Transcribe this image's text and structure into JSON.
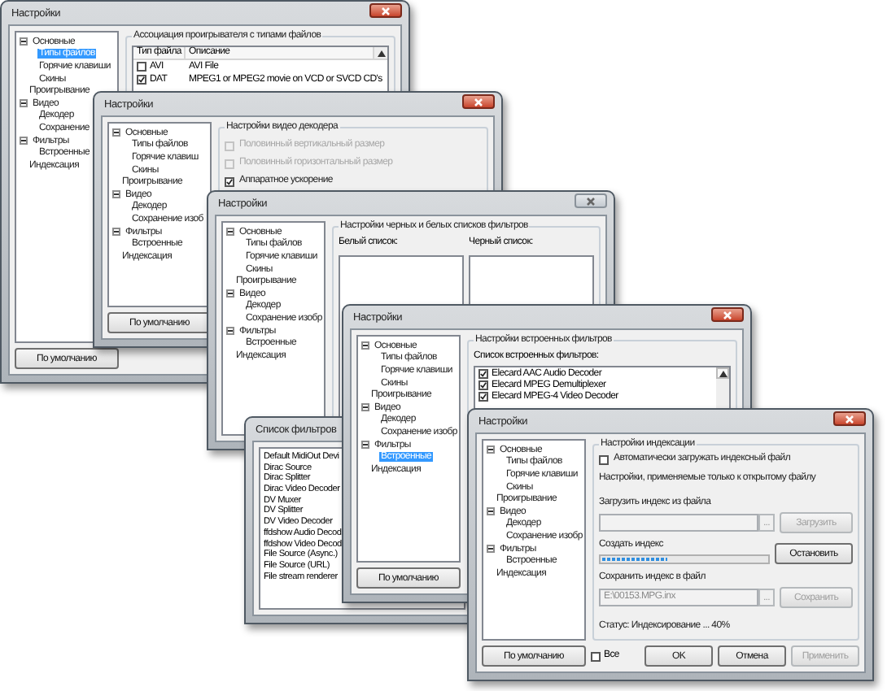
{
  "windows": [
    {
      "kind": "file_types",
      "title": "Настройки",
      "close_button": {
        "active": true
      },
      "default_button": "По умолчанию",
      "tree": [
        {
          "label": "Основные",
          "expanded": true,
          "selected": false,
          "children": [
            {
              "label": "Типы файлов",
              "selected": true
            },
            {
              "label": "Горячие клавиши",
              "selected": false
            },
            {
              "label": "Скины",
              "selected": false
            }
          ]
        },
        {
          "label": "Проигрывание",
          "selected": false
        },
        {
          "label": "Видео",
          "expanded": true,
          "selected": false,
          "children": [
            {
              "label": "Декодер",
              "selected": false
            },
            {
              "label": "Сохранение",
              "selected": false
            }
          ]
        },
        {
          "label": "Фильтры",
          "expanded": true,
          "selected": false,
          "children": [
            {
              "label": "Встроенные",
              "selected": false
            }
          ]
        },
        {
          "label": "Индексация",
          "selected": false
        }
      ],
      "group_title": "Ассоциация проигрывателя с типами файлов",
      "table": {
        "columns": [
          "Тип файла",
          "Описание"
        ],
        "rows": [
          {
            "checked": false,
            "cells": [
              "AVI",
              "AVI File"
            ]
          },
          {
            "checked": true,
            "cells": [
              "DAT",
              "MPEG1 or MPEG2 movie on VCD or SVCD CD's"
            ]
          }
        ]
      }
    },
    {
      "kind": "video_decoder",
      "title": "Настройки",
      "close_button": {
        "active": true
      },
      "default_button": "По умолчанию",
      "tree": [
        {
          "label": "Основные",
          "expanded": true,
          "selected": false,
          "children": [
            {
              "label": "Типы файлов",
              "selected": false
            },
            {
              "label": "Горячие клавиш",
              "selected": false
            },
            {
              "label": "Скины",
              "selected": false
            }
          ]
        },
        {
          "label": "Проигрывание",
          "selected": false
        },
        {
          "label": "Видео",
          "expanded": true,
          "selected": false,
          "children": [
            {
              "label": "Декодер",
              "selected": false
            },
            {
              "label": "Сохранение изоб",
              "selected": false
            }
          ]
        },
        {
          "label": "Фильтры",
          "expanded": true,
          "selected": false,
          "children": [
            {
              "label": "Встроенные",
              "selected": false
            }
          ]
        },
        {
          "label": "Индексация",
          "selected": false
        }
      ],
      "group_title": "Настройки видео декодера",
      "options": [
        {
          "label": "Половинный вертикальный размер",
          "checked": false,
          "disabled": true
        },
        {
          "label": "Половинный горизонтальный размер",
          "checked": false,
          "disabled": true
        },
        {
          "label": "Аппаратное ускорение",
          "checked": true,
          "disabled": false
        }
      ]
    },
    {
      "kind": "filter_lists",
      "title": "Настройки",
      "close_button": {
        "active": false
      },
      "tree": [
        {
          "label": "Основные",
          "expanded": true,
          "selected": false,
          "children": [
            {
              "label": "Типы файлов",
              "selected": false
            },
            {
              "label": "Горячие клавиши",
              "selected": false
            },
            {
              "label": "Скины",
              "selected": false
            }
          ]
        },
        {
          "label": "Проигрывание",
          "selected": false
        },
        {
          "label": "Видео",
          "expanded": true,
          "selected": false,
          "children": [
            {
              "label": "Декодер",
              "selected": false
            },
            {
              "label": "Сохранение изобр",
              "selected": false
            }
          ]
        },
        {
          "label": "Фильтры",
          "expanded": true,
          "selected": false,
          "children": [
            {
              "label": "Встроенные",
              "selected": false
            }
          ]
        },
        {
          "label": "Индексация",
          "selected": false
        }
      ],
      "group_title": "Настройки черных и белых списков фильтров",
      "lists": [
        {
          "label": "Белый список:"
        },
        {
          "label": "Черный список:"
        }
      ]
    },
    {
      "kind": "filter_list",
      "title": "Список фильтров",
      "items": [
        "Default MidiOut Devi",
        "Dirac Source",
        "Dirac Splitter",
        "Dirac Video Decoder",
        "DV Muxer",
        "DV Splitter",
        "DV Video Decoder",
        "ffdshow Audio Decod",
        "ffdshow Video Decod",
        "File Source (Async.)",
        "File Source (URL)",
        "File stream renderer"
      ]
    },
    {
      "kind": "builtin_filters",
      "title": "Настройки",
      "close_button": {
        "active": true
      },
      "default_button": "По умолчанию",
      "tree": [
        {
          "label": "Основные",
          "expanded": true,
          "selected": false,
          "children": [
            {
              "label": "Типы файлов",
              "selected": false
            },
            {
              "label": "Горячие клавиши",
              "selected": false
            },
            {
              "label": "Скины",
              "selected": false
            }
          ]
        },
        {
          "label": "Проигрывание",
          "selected": false
        },
        {
          "label": "Видео",
          "expanded": true,
          "selected": false,
          "children": [
            {
              "label": "Декодер",
              "selected": false
            },
            {
              "label": "Сохранение изобр",
              "selected": false
            }
          ]
        },
        {
          "label": "Фильтры",
          "expanded": true,
          "selected": false,
          "children": [
            {
              "label": "Встроенные",
              "selected": true
            }
          ]
        },
        {
          "label": "Индексация",
          "selected": false
        }
      ],
      "group_title": "Настройки встроенных фильтров",
      "list_label": "Список встроенных фильтров:",
      "filters": [
        {
          "label": "Elecard AAC Audio Decoder",
          "checked": true
        },
        {
          "label": "Elecard MPEG Demultiplexer",
          "checked": true
        },
        {
          "label": "Elecard MPEG-4 Video Decoder",
          "checked": true
        }
      ]
    },
    {
      "kind": "indexing",
      "title": "Настройки",
      "close_button": {
        "active": true
      },
      "default_button": "По умолчанию",
      "tree": [
        {
          "label": "Основные",
          "expanded": true,
          "selected": false,
          "children": [
            {
              "label": "Типы файлов",
              "selected": false
            },
            {
              "label": "Горячие клавиши",
              "selected": false
            },
            {
              "label": "Скины",
              "selected": false
            }
          ]
        },
        {
          "label": "Проигрывание",
          "selected": false
        },
        {
          "label": "Видео",
          "expanded": true,
          "selected": false,
          "children": [
            {
              "label": "Декодер",
              "selected": false
            },
            {
              "label": "Сохранение изобр",
              "selected": false
            }
          ]
        },
        {
          "label": "Фильтры",
          "expanded": true,
          "selected": false,
          "children": [
            {
              "label": "Встроенные",
              "selected": false
            }
          ]
        },
        {
          "label": "Индексация",
          "selected": false
        }
      ],
      "group_title": "Настройки индексации",
      "auto_load": {
        "label": "Автоматически загружать индексный файл",
        "checked": false
      },
      "note": "Настройки, применяемые только к открытому файлу",
      "load": {
        "label": "Загрузить индекс из файла",
        "browse": "...",
        "button": "Загрузить",
        "disabled": true
      },
      "create": {
        "label": "Создать индекс",
        "level": 0.4,
        "button": "Остановить"
      },
      "save": {
        "label": "Сохранить индекс в файл",
        "value": "E:\\00153.MPG.inx",
        "browse": "...",
        "button": "Сохранить",
        "disabled": true
      },
      "status": "Статус: Индексирование ... 40%",
      "all": {
        "label": "Все",
        "checked": false
      },
      "buttons": [
        {
          "label": "OK",
          "disabled": false
        },
        {
          "label": "Отмена",
          "disabled": false
        },
        {
          "label": "Применить",
          "disabled": true
        }
      ]
    }
  ]
}
